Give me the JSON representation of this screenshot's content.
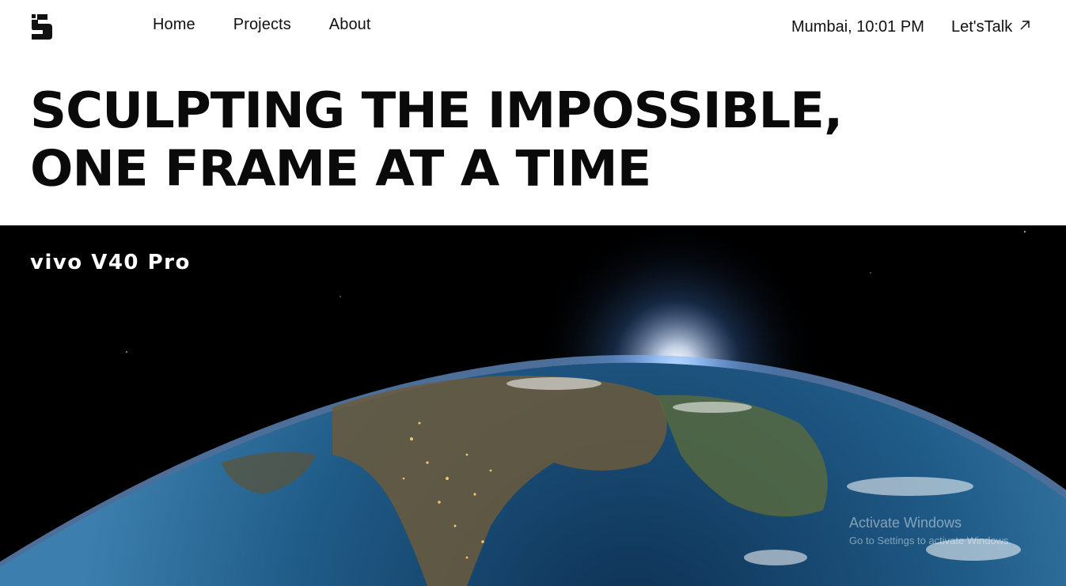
{
  "header": {
    "logo_icon": "s-logo-icon",
    "nav": [
      {
        "label": "Home"
      },
      {
        "label": "Projects"
      },
      {
        "label": "About"
      }
    ],
    "clock": "Mumbai, 10:01 PM",
    "cta_label": "Let'sTalk",
    "cta_icon": "arrow-up-right-icon"
  },
  "hero": {
    "line1": "SCULPTING THE IMPOSSIBLE,",
    "line2": "ONE FRAME AT A TIME"
  },
  "video": {
    "caption": "vivo V40 Pro",
    "scene": "earth-from-space"
  },
  "watermark": {
    "title": "Activate Windows",
    "subtitle": "Go to Settings to activate Windows."
  },
  "colors": {
    "text": "#111111",
    "background": "#ffffff",
    "video_bg": "#000000",
    "ocean": "#1e4f78",
    "atmosphere": "#7fb8ff"
  }
}
